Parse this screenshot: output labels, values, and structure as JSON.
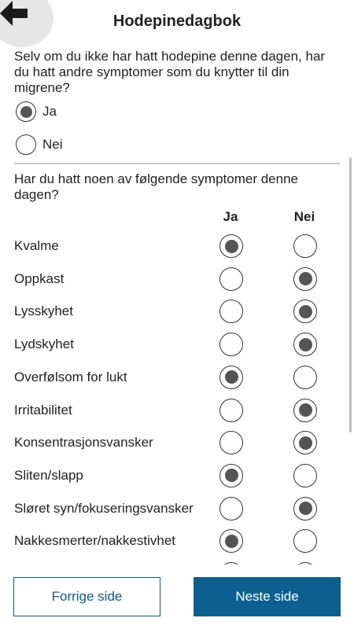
{
  "header": {
    "title": "Hodepinedagbok",
    "back_icon": "arrow-left-icon"
  },
  "question1": {
    "text": "Selv om du ikke har hatt hodepine denne dagen, har du hatt andre symptomer som du knytter til din migrene?",
    "options": [
      {
        "label": "Ja",
        "selected": true
      },
      {
        "label": "Nei",
        "selected": false
      }
    ]
  },
  "question2": {
    "text": "Har du hatt noen av følgende symptomer denne dagen?",
    "col_yes": "Ja",
    "col_no": "Nei",
    "symptoms": [
      {
        "label": "Kvalme",
        "answer": "Ja"
      },
      {
        "label": "Oppkast",
        "answer": "Nei"
      },
      {
        "label": "Lysskyhet",
        "answer": "Nei"
      },
      {
        "label": "Lydskyhet",
        "answer": "Nei"
      },
      {
        "label": "Overfølsom for lukt",
        "answer": "Ja"
      },
      {
        "label": "Irritabilitet",
        "answer": "Nei"
      },
      {
        "label": "Konsentrasjonsvansker",
        "answer": "Nei"
      },
      {
        "label": "Sliten/slapp",
        "answer": "Ja"
      },
      {
        "label": "Sløret syn/fokuseringsvansker",
        "answer": "Nei"
      },
      {
        "label": "Nakkesmerter/nakkestivhet",
        "answer": "Ja"
      }
    ]
  },
  "footer": {
    "prev_label": "Forrige side",
    "next_label": "Neste side"
  },
  "colors": {
    "primary": "#0d5f8f",
    "radio_fill": "#555555",
    "back_circle": "#e6e6e6"
  }
}
